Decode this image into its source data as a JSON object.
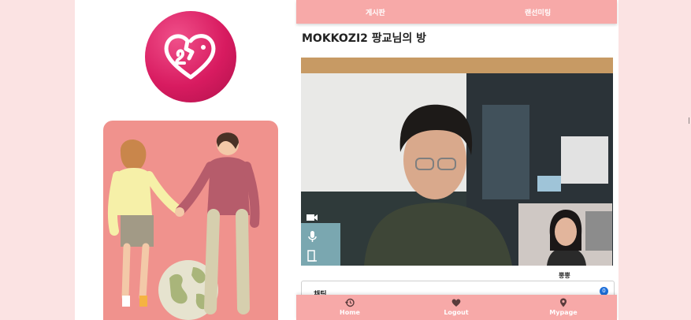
{
  "top_nav": {
    "items": [
      {
        "label": "게시판"
      },
      {
        "label": "랜선미팅"
      }
    ]
  },
  "room": {
    "title": "MOKKOZI2 팡교님의 방"
  },
  "video": {
    "controls": [
      "camera-icon",
      "microphone-icon",
      "exit-door-icon"
    ],
    "participant_name": "뿡뿡"
  },
  "chat": {
    "label": "채팅",
    "unread_count": "0"
  },
  "bottom_nav": {
    "items": [
      {
        "label": "Home",
        "icon": "history-icon"
      },
      {
        "label": "Logout",
        "icon": "heart-icon"
      },
      {
        "label": "Mypage",
        "icon": "location-pin-icon"
      }
    ]
  },
  "colors": {
    "nav_bg": "#f7a9a8",
    "logo": "#d81b60",
    "page_bg": "#fbe3e3",
    "illustration_bg": "#f0928d"
  }
}
